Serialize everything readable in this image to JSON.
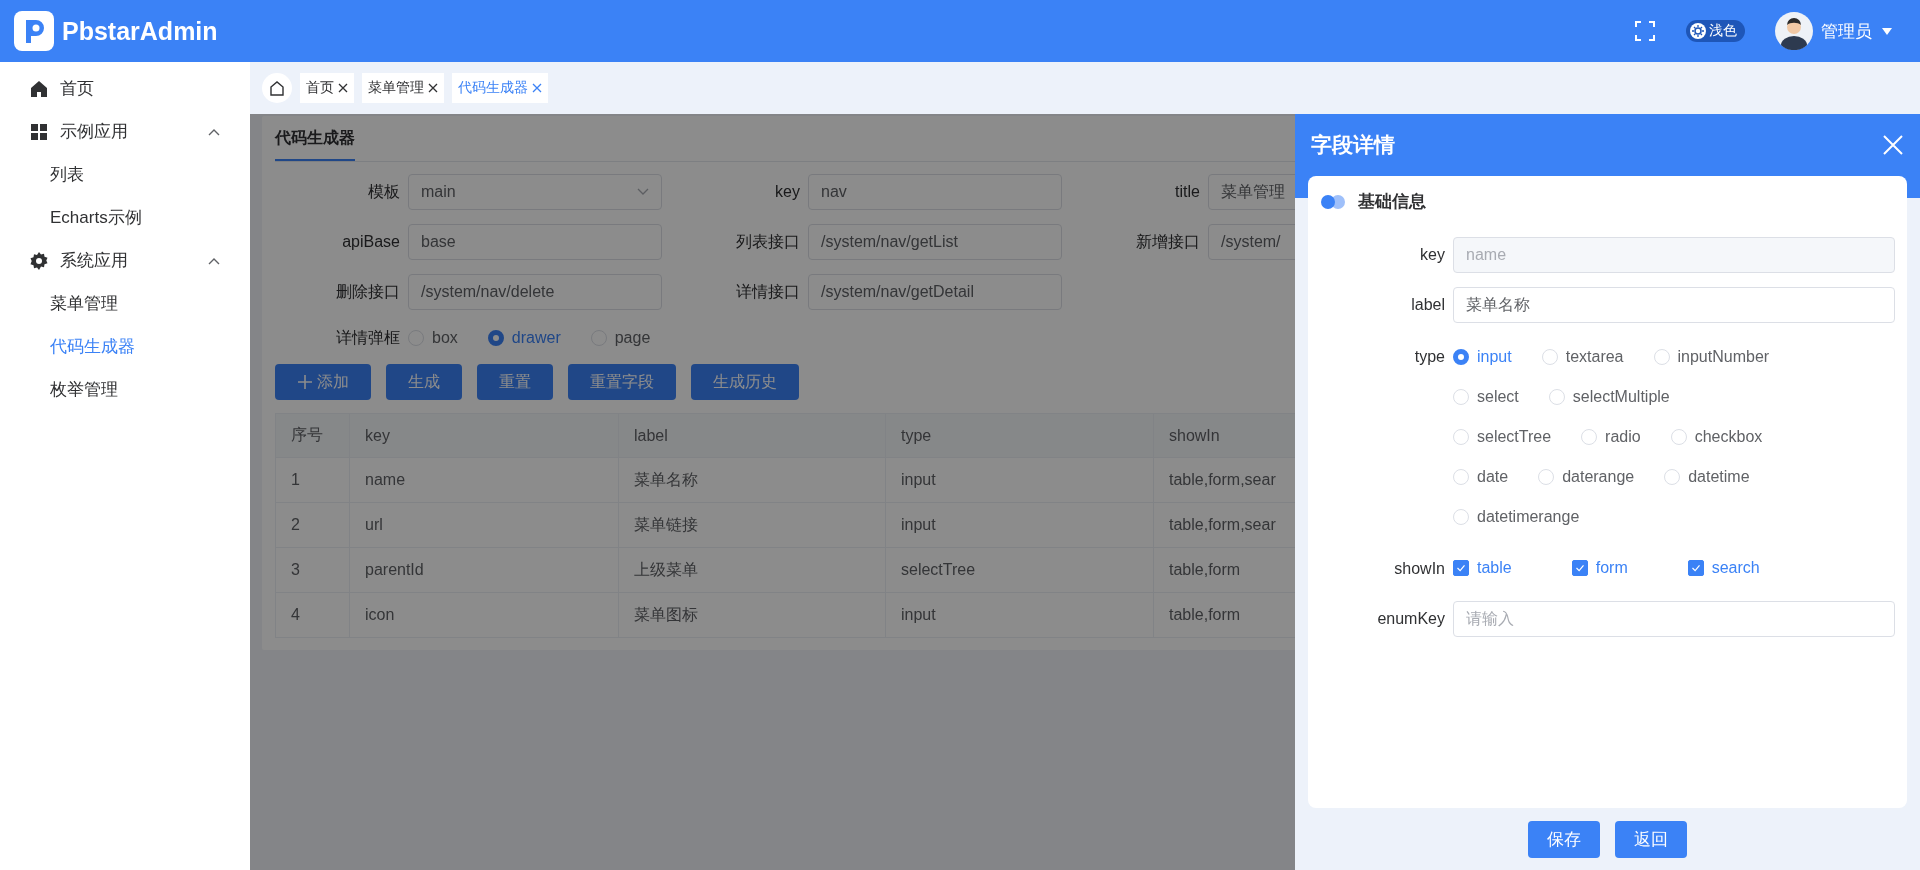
{
  "header": {
    "app_name": "PbstarAdmin",
    "theme_label": "浅色",
    "user_name": "管理员"
  },
  "sidebar": {
    "items": [
      {
        "label": "首页",
        "selected": false
      },
      {
        "label": "示例应用",
        "expanded": true,
        "children": [
          {
            "label": "列表",
            "selected": false
          },
          {
            "label": "Echarts示例",
            "selected": false
          }
        ]
      },
      {
        "label": "系统应用",
        "expanded": true,
        "children": [
          {
            "label": "菜单管理",
            "selected": false
          },
          {
            "label": "代码生成器",
            "selected": true
          },
          {
            "label": "枚举管理",
            "selected": false
          }
        ]
      }
    ]
  },
  "tabs": [
    {
      "label": "首页",
      "selected": false
    },
    {
      "label": "菜单管理",
      "selected": false
    },
    {
      "label": "代码生成器",
      "selected": true
    }
  ],
  "page": {
    "title": "代码生成器",
    "form": {
      "fields": [
        {
          "label": "模板",
          "value": "main",
          "kind": "select"
        },
        {
          "label": "key",
          "value": "nav",
          "kind": "input"
        },
        {
          "label": "title",
          "value": "菜单管理",
          "kind": "input"
        },
        {
          "label": "apiBase",
          "value": "base",
          "kind": "input"
        },
        {
          "label": "列表接口",
          "value": "/system/nav/getList",
          "kind": "input"
        },
        {
          "label": "新增接口",
          "value": "/system/",
          "kind": "input"
        },
        {
          "label": "删除接口",
          "value": "/system/nav/delete",
          "kind": "input"
        },
        {
          "label": "详情接口",
          "value": "/system/nav/getDetail",
          "kind": "input"
        }
      ],
      "radio_group": {
        "label": "详情弹框",
        "options": [
          {
            "label": "box",
            "selected": false
          },
          {
            "label": "drawer",
            "selected": true
          },
          {
            "label": "page",
            "selected": false
          }
        ]
      }
    },
    "buttons": [
      {
        "label": "添加",
        "kind": "add"
      },
      {
        "label": "生成",
        "kind": "plain"
      },
      {
        "label": "重置",
        "kind": "plain"
      },
      {
        "label": "重置字段",
        "kind": "plain"
      },
      {
        "label": "生成历史",
        "kind": "plain"
      }
    ],
    "table": {
      "columns": [
        "序号",
        "key",
        "label",
        "type",
        "showIn"
      ],
      "rows": [
        [
          "1",
          "name",
          "菜单名称",
          "input",
          "table,form,sear"
        ],
        [
          "2",
          "url",
          "菜单链接",
          "input",
          "table,form,sear"
        ],
        [
          "3",
          "parentId",
          "上级菜单",
          "selectTree",
          "table,form"
        ],
        [
          "4",
          "icon",
          "菜单图标",
          "input",
          "table,form"
        ]
      ]
    }
  },
  "drawer": {
    "title": "字段详情",
    "section_title": "基础信息",
    "fields": [
      {
        "label": "key",
        "kind": "input",
        "value": "name",
        "disabled": true
      },
      {
        "label": "label",
        "kind": "input",
        "value": "菜单名称"
      },
      {
        "label": "type",
        "kind": "radio",
        "options": [
          {
            "label": "input",
            "selected": true
          },
          {
            "label": "textarea",
            "selected": false
          },
          {
            "label": "inputNumber",
            "selected": false
          },
          {
            "label": "select",
            "selected": false
          },
          {
            "label": "selectMultiple",
            "selected": false
          },
          {
            "label": "selectTree",
            "selected": false
          },
          {
            "label": "radio",
            "selected": false
          },
          {
            "label": "checkbox",
            "selected": false
          },
          {
            "label": "date",
            "selected": false
          },
          {
            "label": "daterange",
            "selected": false
          },
          {
            "label": "datetime",
            "selected": false
          },
          {
            "label": "datetimerange",
            "selected": false
          }
        ]
      },
      {
        "label": "showIn",
        "kind": "checkbox",
        "options": [
          {
            "label": "table",
            "checked": true
          },
          {
            "label": "form",
            "checked": true
          },
          {
            "label": "search",
            "checked": true
          }
        ]
      },
      {
        "label": "enumKey",
        "kind": "input",
        "placeholder": "请输入"
      }
    ],
    "buttons": [
      "保存",
      "返回"
    ]
  }
}
